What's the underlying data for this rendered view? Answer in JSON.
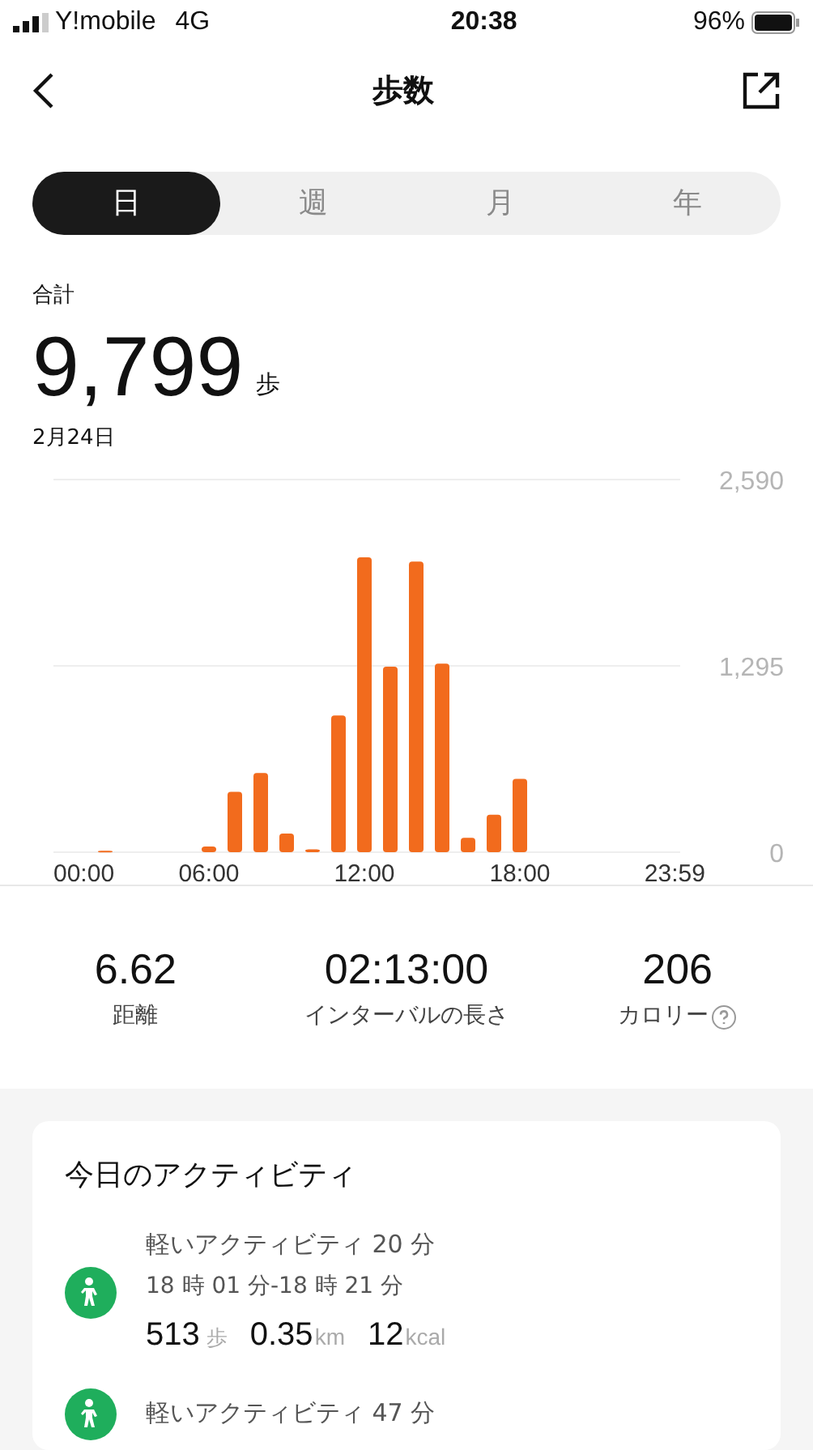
{
  "status_bar": {
    "carrier": "Y!mobile",
    "network": "4G",
    "time": "20:38",
    "battery": "96%"
  },
  "nav": {
    "title": "歩数"
  },
  "tabs": [
    {
      "label": "日",
      "selected": true
    },
    {
      "label": "週",
      "selected": false
    },
    {
      "label": "月",
      "selected": false
    },
    {
      "label": "年",
      "selected": false
    }
  ],
  "summary": {
    "label": "合計",
    "value": "9,799",
    "unit": "歩",
    "date": "2月24日"
  },
  "chart_data": {
    "type": "bar",
    "x": [
      2,
      6,
      7,
      8,
      9,
      10,
      11,
      12,
      13,
      14,
      15,
      16,
      17,
      18
    ],
    "series": [
      {
        "color": "#f26b1d",
        "values": [
          10,
          40,
          420,
          550,
          130,
          20,
          950,
          2050,
          1290,
          2020,
          1310,
          100,
          260,
          510
        ]
      }
    ],
    "xlim": [
      0,
      24
    ],
    "ylim": [
      0,
      2590
    ],
    "yticks": [
      {
        "value": 0,
        "label": "0"
      },
      {
        "value": 1295,
        "label": "1,295"
      },
      {
        "value": 2590,
        "label": "2,590"
      }
    ],
    "xticks": [
      {
        "value": 0,
        "label": "00:00"
      },
      {
        "value": 6,
        "label": "06:00"
      },
      {
        "value": 12,
        "label": "12:00"
      },
      {
        "value": 18,
        "label": "18:00"
      },
      {
        "value": 23.98,
        "label": "23:59"
      }
    ]
  },
  "stats": [
    {
      "value": "6.62",
      "label": "距離",
      "help": false
    },
    {
      "value": "02:13:00",
      "label": "インターバルの長さ",
      "help": false
    },
    {
      "value": "206",
      "label": "カロリー",
      "help": true
    }
  ],
  "activities": {
    "title": "今日のアクティビティ",
    "items": [
      {
        "name": "軽いアクティビティ 20 分",
        "time": "18 時 01 分-18 時 21 分",
        "steps": "513",
        "steps_unit": "歩",
        "distance": "0.35",
        "distance_unit": "km",
        "calories": "12",
        "calories_unit": "kcal"
      },
      {
        "name": "軽いアクティビティ 47 分"
      }
    ]
  }
}
